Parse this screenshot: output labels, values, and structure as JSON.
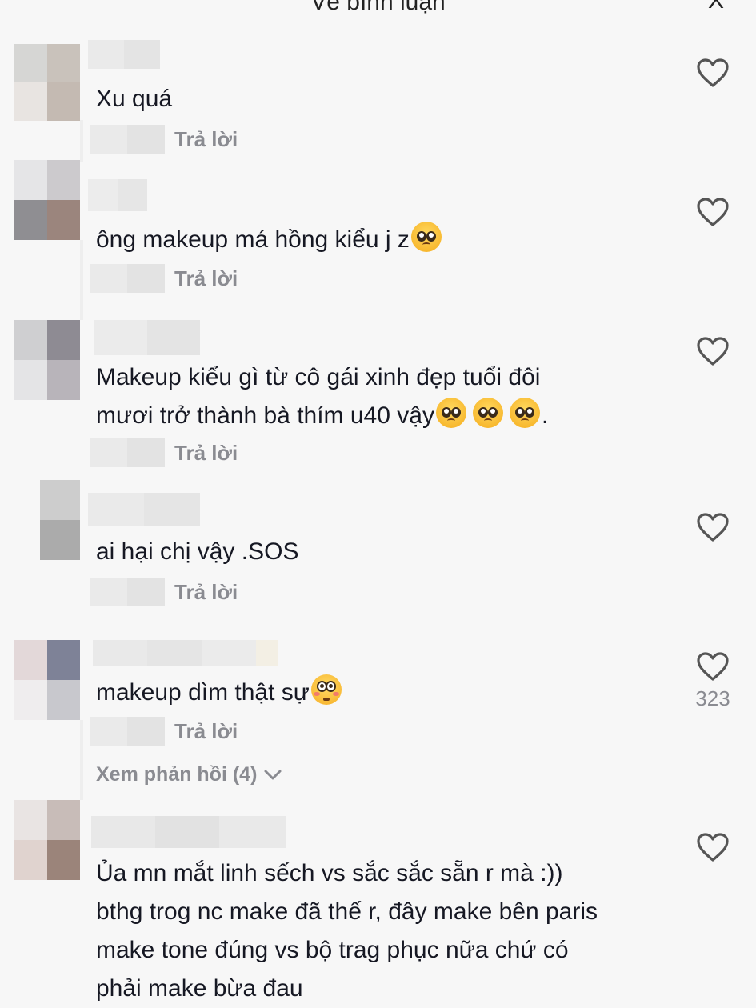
{
  "header": {
    "title": "Về bình luận",
    "close_glyph": "X"
  },
  "reply_label": "Trả lời",
  "comments": [
    {
      "text": "Xu quá",
      "avatar_colors": [
        "#d6d6d4",
        "#c9c2bb",
        "#e8e4e1",
        "#c4bab2"
      ],
      "username_colors": [
        "#eaeaea",
        "#e4e4e4"
      ]
    },
    {
      "text": "ông makeup má hồng kiểu j z",
      "avatar_colors": [
        "#e5e5e7",
        "#cccacd",
        "#8f8e92",
        "#9b857d"
      ],
      "username_colors": [
        "#ececec",
        "#e6e6e6"
      ]
    },
    {
      "line1": "Makeup kiểu gì từ cô gái xinh đẹp tuổi đôi",
      "line2_text": "mươi trở thành bà thím u40 vậy",
      "line2_tail": ".",
      "avatar_colors": [
        "#cfcfd1",
        "#8e8b93",
        "#e4e4e6",
        "#b8b4ba"
      ],
      "username_colors": [
        "#ebebeb",
        "#e4e4e4"
      ]
    },
    {
      "text": "ai hại chị vậy .SOS",
      "avatar_colors": [
        "#f3f3f3",
        "#cdcdcd",
        "#f1f1f1",
        "#ababab"
      ],
      "username_colors": [
        "#eaeaea",
        "#e5e5e5"
      ]
    },
    {
      "text": "makeup dìm thật sự",
      "like_count": "323",
      "avatar_colors": [
        "#e3d8d9",
        "#7e8297",
        "#efedee",
        "#c8c8cd"
      ],
      "username_colors": [
        "#e9e9e9",
        "#e5e5e5"
      ],
      "view_replies": "Xem phản hồi (4)"
    },
    {
      "line1": "Ủa mn mắt linh sếch vs sắc sắc sẵn r mà :))",
      "line2": "bthg trog nc make đã thế r, đây make bên paris",
      "line3": "make tone đúng vs bộ trag phục nữa chứ có",
      "line4": "phải make bừa đau",
      "avatar_colors": [
        "#e9e4e3",
        "#c8bcb8",
        "#e0d3cf",
        "#9b847a"
      ],
      "username_colors": [
        "#e8e8e8",
        "#e2e2e2"
      ]
    }
  ],
  "icons": {
    "like": "heart-outline-icon",
    "expand": "chevron-down-icon",
    "emoji_pleading": "pleading-face-icon",
    "emoji_flushed": "flushed-face-icon"
  }
}
